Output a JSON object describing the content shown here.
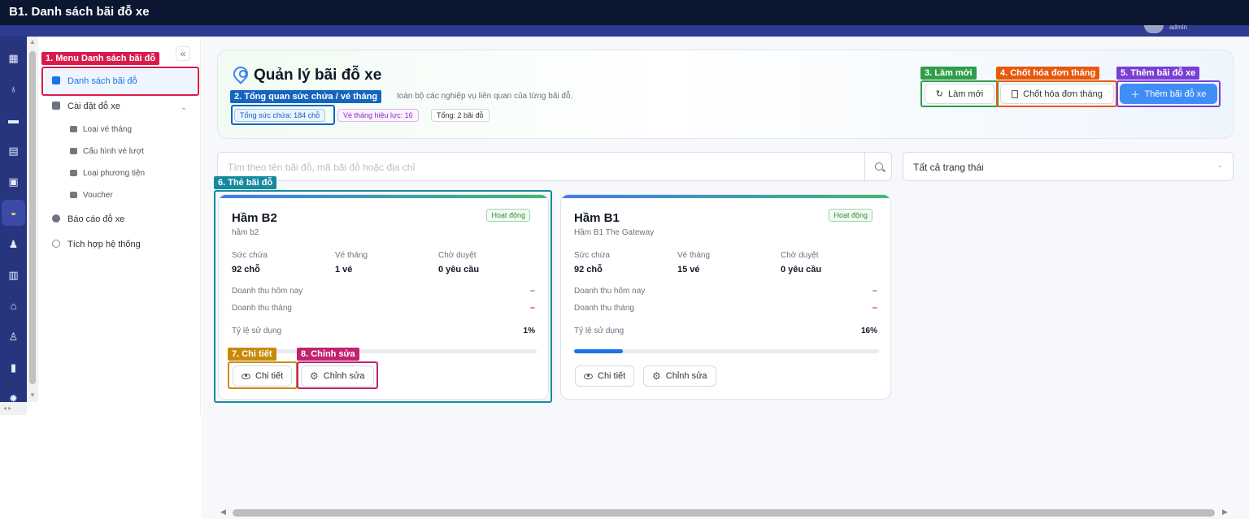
{
  "window": {
    "title": "B1. Danh sách bãi đỗ xe"
  },
  "user": {
    "name": "admin"
  },
  "rail": {
    "icons": [
      "building-icon",
      "route-icon",
      "chat-icon",
      "calculator-icon",
      "briefcase-icon",
      "car-icon",
      "users-icon",
      "company-icon",
      "store-icon",
      "person-icon",
      "chart-icon",
      "gear-icon"
    ]
  },
  "menu": {
    "items": [
      {
        "label": "Danh sách bãi đỗ"
      },
      {
        "label": "Cài đặt đỗ xe"
      },
      {
        "label": "Loại vé tháng"
      },
      {
        "label": "Cấu hình vé lượt"
      },
      {
        "label": "Loại phương tiện"
      },
      {
        "label": "Voucher"
      },
      {
        "label": "Báo cáo đỗ xe"
      },
      {
        "label": "Tích hợp hệ thống"
      }
    ]
  },
  "header": {
    "title": "Quản lý bãi đỗ xe",
    "desc": "toàn bộ các nghiệp vụ liên quan của từng bãi đỗ.",
    "pills": [
      "Tổng sức chứa: 184 chỗ",
      "Vé tháng hiệu lực: 16",
      "Tổng: 2 bãi đỗ"
    ],
    "buttons": {
      "refresh": "Làm mới",
      "close_invoice": "Chốt hóa đơn tháng",
      "add": "Thêm bãi đỗ xe"
    }
  },
  "filters": {
    "search_placeholder": "Tìm theo tên bãi đỗ, mã bãi đỗ hoặc địa chỉ",
    "status_selected": "Tất cả trạng thái"
  },
  "card_labels": {
    "capacity": "Sức chứa",
    "monthly": "Vé tháng",
    "pending": "Chờ duyệt",
    "revenue_today": "Doanh thu hôm nay",
    "revenue_month": "Doanh thu tháng",
    "usage": "Tỷ lệ sử dụng",
    "detail_button": "Chi tiết",
    "edit_button": "Chỉnh sửa"
  },
  "cards": [
    {
      "name": "Hầm B2",
      "code": "hầm b2",
      "status": "Hoạt động",
      "capacity": "92 chỗ",
      "monthly": "1 vé",
      "pending": "0 yêu cầu",
      "revenue_today": "–",
      "revenue_month": "–",
      "usage": "1%",
      "usage_fraction": 0.01
    },
    {
      "name": "Hầm B1",
      "code": "Hầm B1 The Gateway",
      "status": "Hoạt động",
      "capacity": "92 chỗ",
      "monthly": "15 vé",
      "pending": "0 yêu cầu",
      "revenue_today": "–",
      "revenue_month": "–",
      "usage": "16%",
      "usage_fraction": 0.16
    }
  ],
  "annotations": [
    {
      "label": "1. Menu Danh sách bãi đỗ",
      "color": "#d81b4a"
    },
    {
      "label": "2. Tổng quan sức chứa / vé tháng",
      "color": "#1565c0"
    },
    {
      "label": "3. Làm mới",
      "color": "#2e9e48"
    },
    {
      "label": "4. Chốt hóa đơn tháng",
      "color": "#e8590c"
    },
    {
      "label": "5. Thêm bãi đỗ xe",
      "color": "#7b3fd1"
    },
    {
      "label": "6. Thẻ bãi đỗ",
      "color": "#168a9e"
    },
    {
      "label": "7. Chi tiết",
      "color": "#c98a0a"
    },
    {
      "label": "8. Chỉnh sửa",
      "color": "#c2226e"
    }
  ],
  "colors": {
    "accent": "#1a73e8",
    "primary_button": "#3f8ef5",
    "topbar": "#0b1730",
    "rail": "#26357e",
    "revenue_today_dash": "#2fa84f",
    "revenue_month_dash": "#d32f2f"
  }
}
